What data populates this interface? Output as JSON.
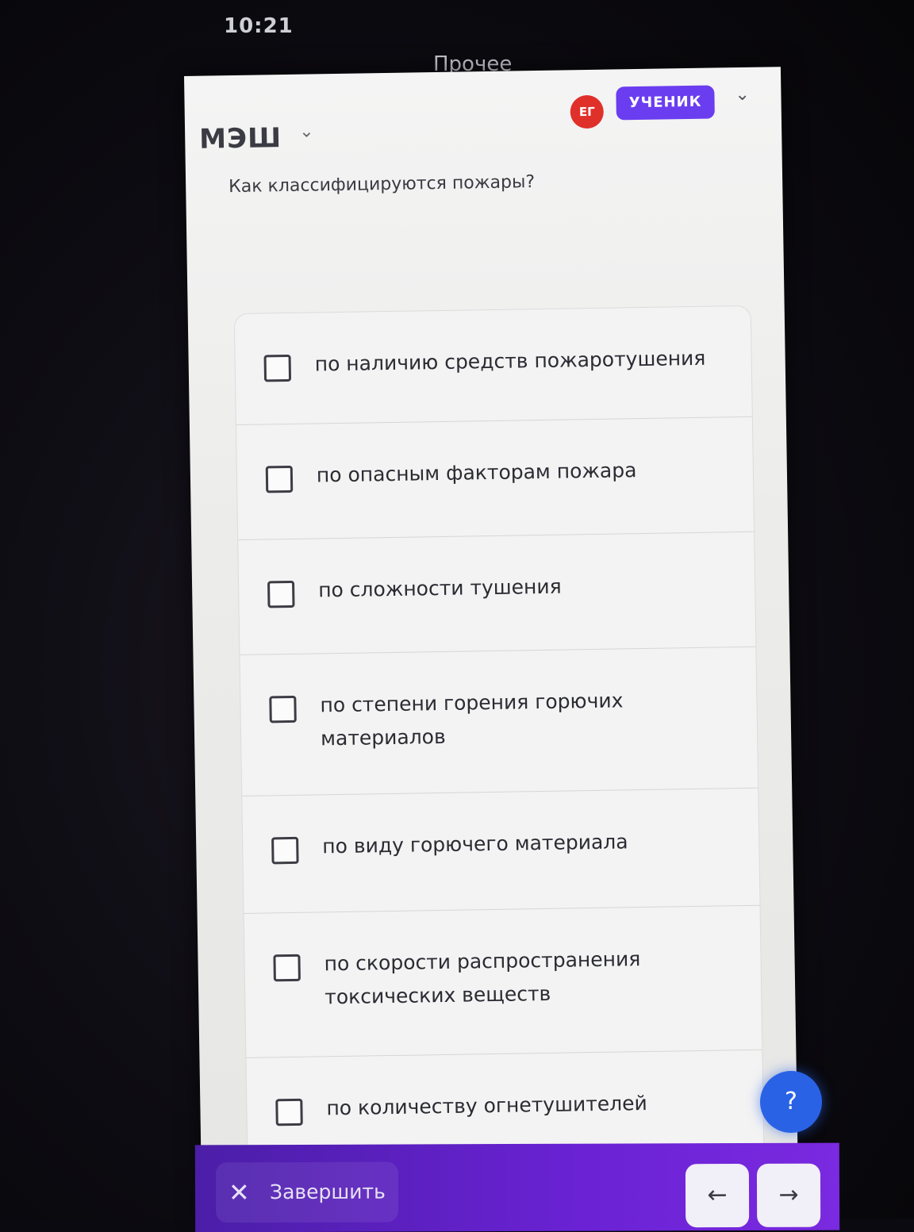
{
  "status_bar": {
    "time": "10:21"
  },
  "nav": {
    "title": "Прочее",
    "back_icon": "chevron-left-icon"
  },
  "header": {
    "logo": "МЭШ",
    "avatar_initials": "ЕГ",
    "role": "УЧЕНИК",
    "avatar_color": "#e0302a",
    "role_color": "#6a3df0"
  },
  "question": "Как классифицируются пожары?",
  "options": [
    {
      "label": "по наличию средств пожаротушения",
      "checked": false
    },
    {
      "label": "по опасным факторам пожара",
      "checked": false
    },
    {
      "label": "по сложности тушения",
      "checked": false
    },
    {
      "label": "по степени горения горючих материалов",
      "checked": false
    },
    {
      "label": "по виду горючего материала",
      "checked": false
    },
    {
      "label": "по скорости распространения токсических веществ",
      "checked": false
    },
    {
      "label": "по количеству огнетушителей",
      "checked": false
    }
  ],
  "help": {
    "label": "?"
  },
  "footer": {
    "finish_label": "Завершить",
    "prev_icon": "arrow-left-icon",
    "next_icon": "arrow-right-icon",
    "accent": "#6a22d4"
  }
}
